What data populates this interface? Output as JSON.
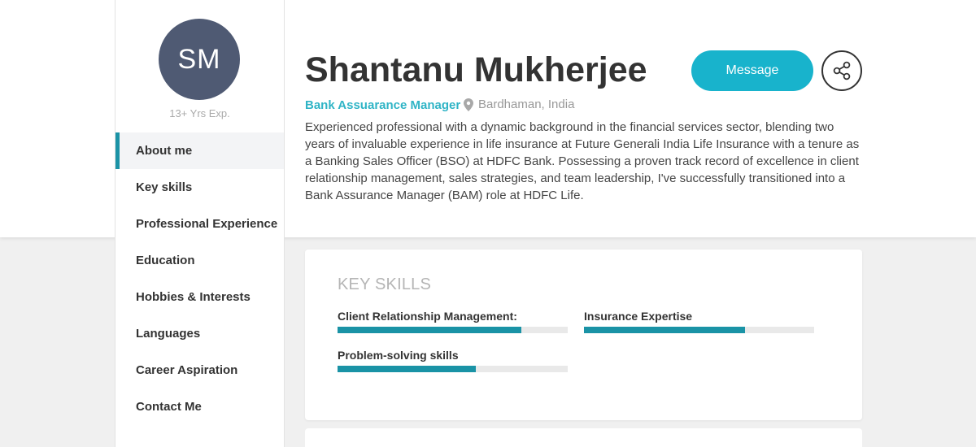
{
  "profile": {
    "initials": "SM",
    "experience": "13+ Yrs Exp.",
    "name": "Shantanu Mukherjee",
    "role": "Bank Assuarance Manager",
    "location": "Bardhaman, India",
    "bio": "Experienced professional with a dynamic background in the financial services sector, blending two years of invaluable experience in life insurance at Future Generali India Life Insurance with a tenure as a Banking Sales Officer (BSO) at HDFC Bank. Possessing a proven track record of excellence in client relationship management, sales strategies, and team leadership, I've successfully transitioned into a Bank Assurance Manager (BAM) role at HDFC Life."
  },
  "actions": {
    "message_label": "Message",
    "share_icon": "share-icon"
  },
  "nav": {
    "items": [
      {
        "label": "About me",
        "active": true
      },
      {
        "label": "Key skills"
      },
      {
        "label": "Professional Experience"
      },
      {
        "label": "Education"
      },
      {
        "label": "Hobbies & Interests"
      },
      {
        "label": "Languages"
      },
      {
        "label": "Career Aspiration"
      },
      {
        "label": "Contact Me"
      }
    ]
  },
  "skills_card": {
    "title": "KEY SKILLS",
    "skills": [
      {
        "name": "Client Relationship Management:",
        "level": 0.8
      },
      {
        "name": "Insurance Expertise",
        "level": 0.7
      },
      {
        "name": "Problem-solving skills",
        "level": 0.6
      }
    ]
  },
  "colors": {
    "accent": "#18b3cc",
    "avatar_bg": "#4f5a73",
    "skill_bar": "#1a93a6",
    "role_text": "#2fb4c6"
  }
}
